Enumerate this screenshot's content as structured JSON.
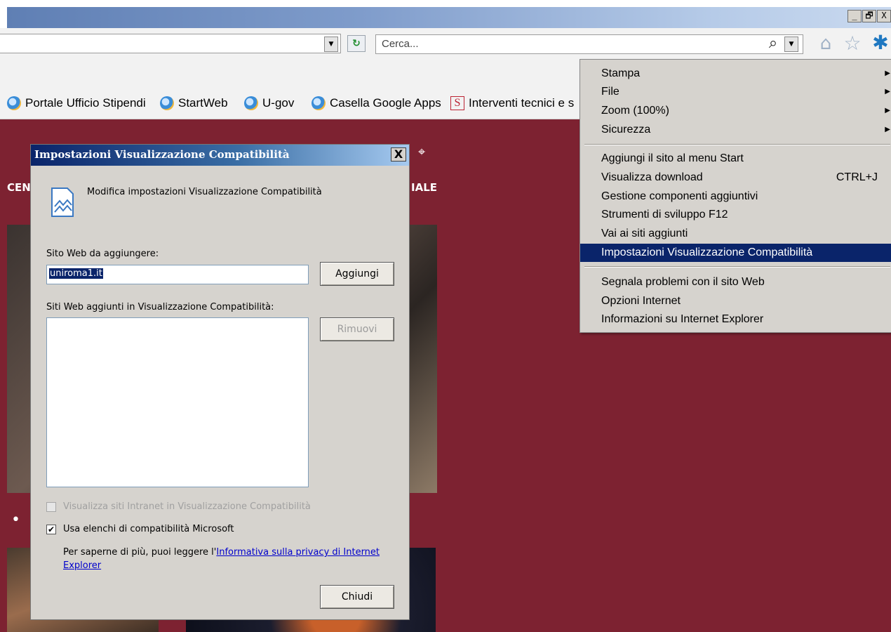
{
  "window": {
    "minimize": "_",
    "restore": "🗗",
    "close": "X"
  },
  "toolbar": {
    "search_placeholder": "Cerca...",
    "dropdown_glyph": "▼",
    "refresh_glyph": "↻",
    "search_glyph": "⌕",
    "home_glyph": "⌂",
    "star_glyph": "☆",
    "gear_glyph": "✱"
  },
  "favorites": [
    {
      "label": "Portale Ufficio Stipendi",
      "icon": "ie-icon"
    },
    {
      "label": "StartWeb",
      "icon": "ie-icon"
    },
    {
      "label": "U-gov",
      "icon": "ie-icon"
    },
    {
      "label": "Casella Google Apps",
      "icon": "ie-icon"
    },
    {
      "label": "Interventi tecnici e s",
      "icon": "s-icon",
      "icon_text": "S"
    }
  ],
  "page": {
    "menu_left": "CENT",
    "menu_right": "IALE",
    "dots": "• •"
  },
  "dialog": {
    "title": "Impostazioni Visualizzazione Compatibilità",
    "close_label": "X",
    "heading": "Modifica impostazioni Visualizzazione Compatibilità",
    "add_label": "Sito Web da aggiungere:",
    "add_value": "uniroma1.it",
    "add_button": "Aggiungi",
    "list_label": "Siti Web aggiunti in Visualizzazione Compatibilità:",
    "remove_button": "Rimuovi",
    "intranet_checkbox": "Visualizza siti Intranet in Visualizzazione Compatibilità",
    "intranet_checked": false,
    "ms_lists_checkbox": "Usa elenchi di compatibilità Microsoft",
    "ms_lists_checked": true,
    "check_mark": "✔",
    "privacy_prefix": "Per saperne di più, puoi leggere l'",
    "privacy_link_1": "Informativa sulla privacy di Internet",
    "privacy_link_2": "Explorer",
    "close_button": "Chiudi"
  },
  "tools_menu": {
    "arrow": "▶",
    "items": [
      {
        "label": "Stampa",
        "submenu": true
      },
      {
        "label": "File",
        "submenu": true
      },
      {
        "label": "Zoom (100%)",
        "submenu": true
      },
      {
        "label": "Sicurezza",
        "submenu": true
      },
      {
        "label": "Aggiungi il sito al menu Start"
      },
      {
        "label": "Visualizza download",
        "shortcut": "CTRL+J"
      },
      {
        "label": "Gestione componenti aggiuntivi"
      },
      {
        "label": "Strumenti di sviluppo F12"
      },
      {
        "label": "Vai ai siti aggiunti"
      },
      {
        "label": "Impostazioni Visualizzazione Compatibilità",
        "selected": true
      },
      {
        "label": "Segnala problemi con il sito Web"
      },
      {
        "label": "Opzioni Internet"
      },
      {
        "label": "Informazioni su Internet Explorer"
      }
    ]
  }
}
